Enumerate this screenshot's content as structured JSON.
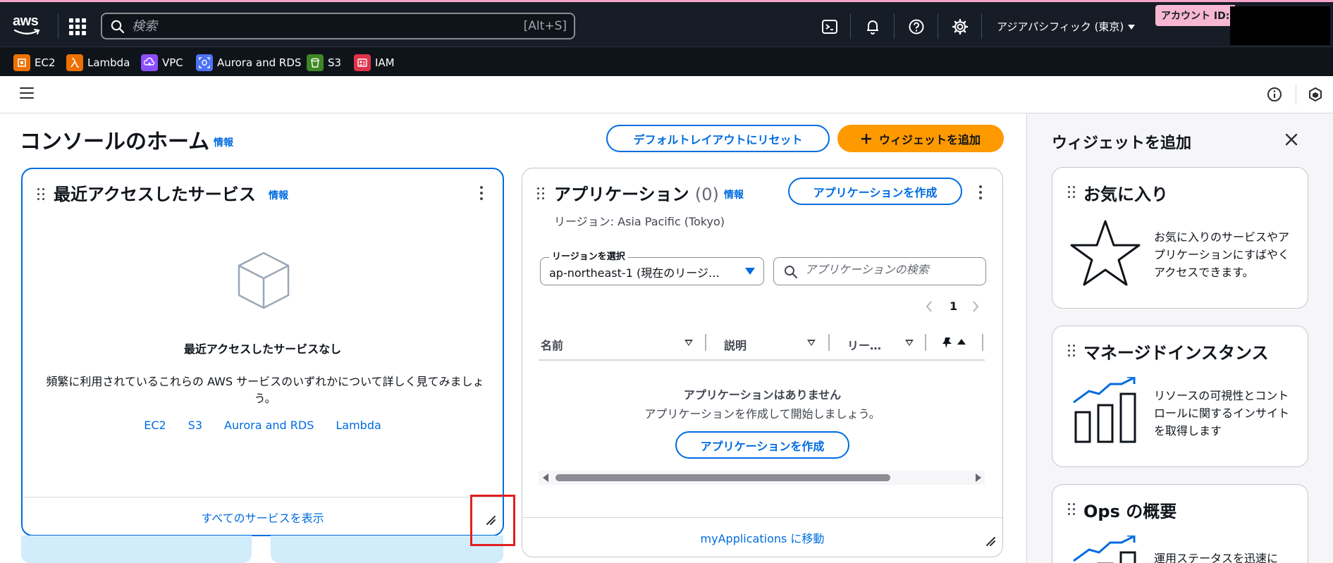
{
  "topnav": {
    "logo_text": "aws",
    "search_placeholder": "検索",
    "search_shortcut": "[Alt+S]",
    "region": "アジアパシフィック (東京)",
    "account_label": "アカウント ID:"
  },
  "services": [
    {
      "label": "EC2",
      "color": "#ed7100",
      "icon": "ec2-icon"
    },
    {
      "label": "Lambda",
      "color": "#ed7100",
      "icon": "lambda-icon"
    },
    {
      "label": "VPC",
      "color": "#8c4fff",
      "icon": "vpc-icon"
    },
    {
      "label": "Aurora and RDS",
      "color": "#4d72f3",
      "icon": "rds-icon"
    },
    {
      "label": "S3",
      "color": "#3f8624",
      "icon": "s3-icon"
    },
    {
      "label": "IAM",
      "color": "#dd344c",
      "icon": "iam-icon"
    }
  ],
  "main": {
    "title": "コンソールのホーム",
    "info": "情報",
    "reset_button": "デフォルトレイアウトにリセット",
    "add_widget_button": "ウィジェットを追加"
  },
  "recent": {
    "title": "最近アクセスしたサービス",
    "info": "情報",
    "empty_title": "最近アクセスしたサービスなし",
    "empty_body": "頻繁に利用されているこれらの AWS サービスのいずれかについて詳しく見てみましょう。",
    "links": [
      "EC2",
      "S3",
      "Aurora and RDS",
      "Lambda"
    ],
    "footer_link": "すべてのサービスを表示"
  },
  "apps": {
    "title": "アプリケーション",
    "count": "(0)",
    "info": "情報",
    "create_button": "アプリケーションを作成",
    "region_line": "リージョン: Asia Pacific (Tokyo)",
    "region_select_label": "リージョンを選択",
    "region_select_value": "ap-northeast-1 (現在のリージ…",
    "search_placeholder": "アプリケーションの検索",
    "page_number": "1",
    "columns": [
      "名前",
      "説明",
      "リー…"
    ],
    "empty_title": "アプリケーションはありません",
    "empty_body": "アプリケーションを作成して開始しましょう。",
    "empty_create_button": "アプリケーションを作成",
    "footer_link": "myApplications に移動"
  },
  "add_panel": {
    "title": "ウィジェットを追加",
    "widgets": [
      {
        "title": "お気に入り",
        "desc": "お気に入りのサービスやアプリケーションにすばやくアクセスできます。",
        "icon": "star-icon"
      },
      {
        "title": "マネージドインスタンス",
        "desc": "リソースの可視性とコントロールに関するインサイトを取得します",
        "icon": "chart-icon"
      },
      {
        "title": "Ops の概要",
        "desc": "運用ステータスを迅速に",
        "icon": "chart-icon"
      }
    ]
  },
  "colors": {
    "nav_bg": "#161d26",
    "accent_blue": "#006ce0",
    "primary_orange": "#ff9900",
    "account_pink": "#f7b6d2"
  }
}
